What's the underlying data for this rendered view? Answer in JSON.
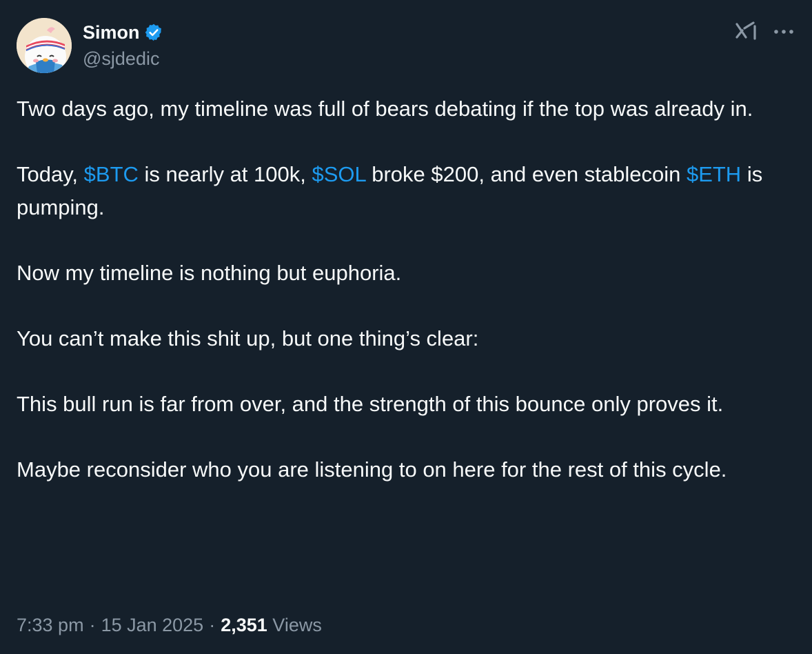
{
  "author": {
    "display_name": "Simon",
    "handle": "@sjdedic",
    "verified": true
  },
  "icons": {
    "verified": "verified-badge-icon",
    "grok": "grok-icon",
    "more": "more-options-icon"
  },
  "colors": {
    "background": "#15202b",
    "text": "#f7f9f9",
    "muted": "#8b98a5",
    "accent": "#1d9bf0"
  },
  "body": {
    "p1": "Two days ago, my timeline was full of bears debating if the top was already in.",
    "p2": {
      "t1": "Today, ",
      "c1": "$BTC",
      "t2": " is nearly at 100k, ",
      "c2": "$SOL",
      "t3": " broke $200, and even stablecoin ",
      "c3": "$ETH",
      "t4": " is pumping."
    },
    "p3": "Now my timeline is nothing but euphoria.",
    "p4": "You can’t make this shit up, but one thing’s clear:",
    "p5": "This bull run is far from over, and the strength of this bounce only proves it.",
    "p6": "Maybe reconsider who you are listening to on here for the rest of this cycle."
  },
  "meta": {
    "time": "7:33 pm",
    "separator": "·",
    "date": "15 Jan 2025",
    "views_count": "2,351",
    "views_label": "Views"
  }
}
